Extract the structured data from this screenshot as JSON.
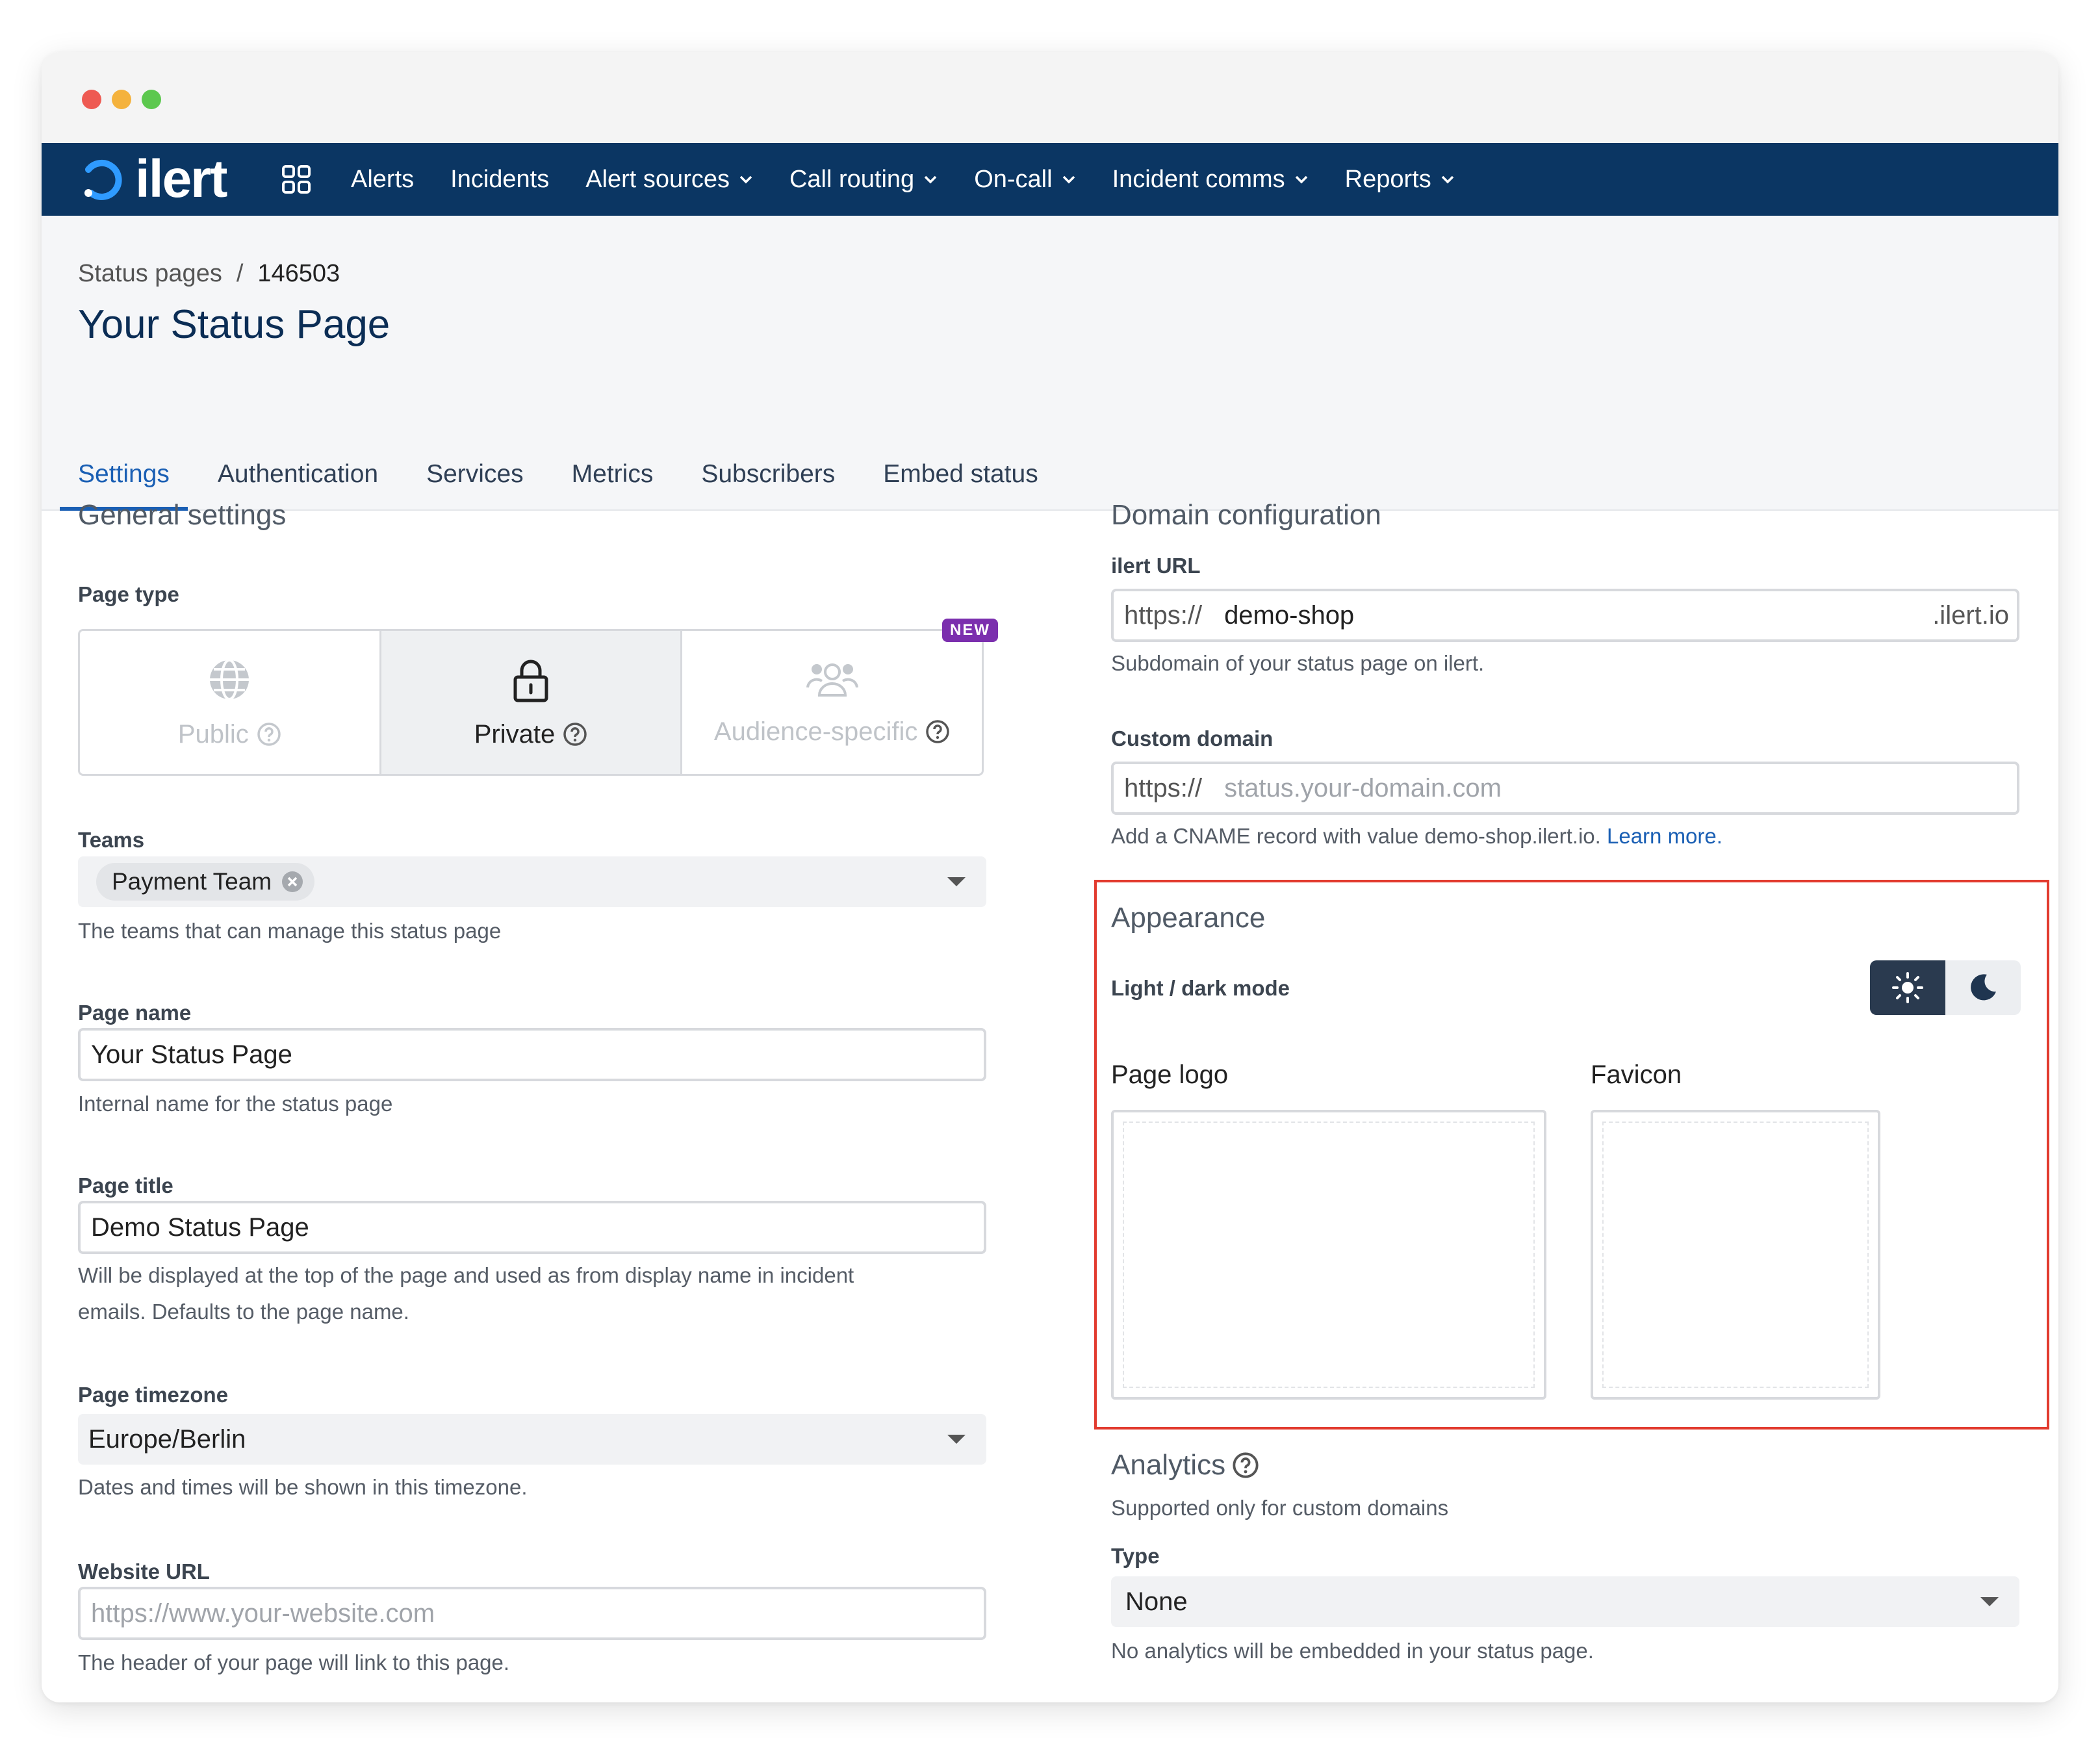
{
  "window": {
    "controls": [
      "close",
      "minimize",
      "maximize"
    ]
  },
  "nav": {
    "logo_text": "ilert",
    "apps_icon": "grid-icon",
    "items": [
      {
        "label": "Alerts",
        "dropdown": false
      },
      {
        "label": "Incidents",
        "dropdown": false
      },
      {
        "label": "Alert sources",
        "dropdown": true
      },
      {
        "label": "Call routing",
        "dropdown": true
      },
      {
        "label": "On-call",
        "dropdown": true
      },
      {
        "label": "Incident comms",
        "dropdown": true
      },
      {
        "label": "Reports",
        "dropdown": true
      }
    ]
  },
  "breadcrumb": {
    "parent": "Status pages",
    "separator": "/",
    "current": "146503"
  },
  "page_title": "Your Status Page",
  "tabs": [
    {
      "label": "Settings",
      "active": true
    },
    {
      "label": "Authentication",
      "active": false
    },
    {
      "label": "Services",
      "active": false
    },
    {
      "label": "Metrics",
      "active": false
    },
    {
      "label": "Subscribers",
      "active": false
    },
    {
      "label": "Embed status",
      "active": false
    }
  ],
  "general": {
    "title": "General settings",
    "page_type": {
      "label": "Page type",
      "options": [
        {
          "label": "Public",
          "icon": "globe-icon",
          "selected": false
        },
        {
          "label": "Private",
          "icon": "lock-icon",
          "selected": true
        },
        {
          "label": "Audience-specific",
          "icon": "users-icon",
          "selected": false
        }
      ],
      "new_badge": "NEW"
    },
    "teams": {
      "label": "Teams",
      "chip": "Payment Team",
      "help": "The teams that can manage this status page"
    },
    "page_name": {
      "label": "Page name",
      "value": "Your Status Page",
      "help": "Internal name for the status page"
    },
    "page_title": {
      "label": "Page title",
      "value": "Demo Status Page",
      "help_line1": "Will be displayed at the top of the page and used as from display name in incident",
      "help_line2": "emails. Defaults to the page name."
    },
    "timezone": {
      "label": "Page timezone",
      "value": "Europe/Berlin",
      "help": "Dates and times will be shown in this timezone."
    },
    "website_url": {
      "label": "Website URL",
      "placeholder": "https://www.your-website.com",
      "help": "The header of your page will link to this page."
    }
  },
  "domain": {
    "title": "Domain configuration",
    "ilert_url": {
      "label": "ilert URL",
      "prefix": "https://",
      "value": "demo-shop",
      "suffix": ".ilert.io",
      "help": "Subdomain of your status page on ilert."
    },
    "custom_domain": {
      "label": "Custom domain",
      "prefix": "https://",
      "placeholder": "status.your-domain.com",
      "help": "Add a CNAME record with value demo-shop.ilert.io.",
      "help_link": "Learn more."
    }
  },
  "appearance": {
    "title": "Appearance",
    "mode_label": "Light / dark mode",
    "mode": "light",
    "page_logo_label": "Page logo",
    "favicon_label": "Favicon",
    "highlight_color": "#e23b2f"
  },
  "analytics": {
    "title": "Analytics",
    "subtitle": "Supported only for custom domains",
    "type_label": "Type",
    "type_value": "None",
    "help": "No analytics will be embedded in your status page."
  },
  "colors": {
    "nav_bg": "#0b3663",
    "accent": "#1a5fb4",
    "badge_new": "#7b2fae",
    "toggle_active": "#2a3a4f"
  }
}
